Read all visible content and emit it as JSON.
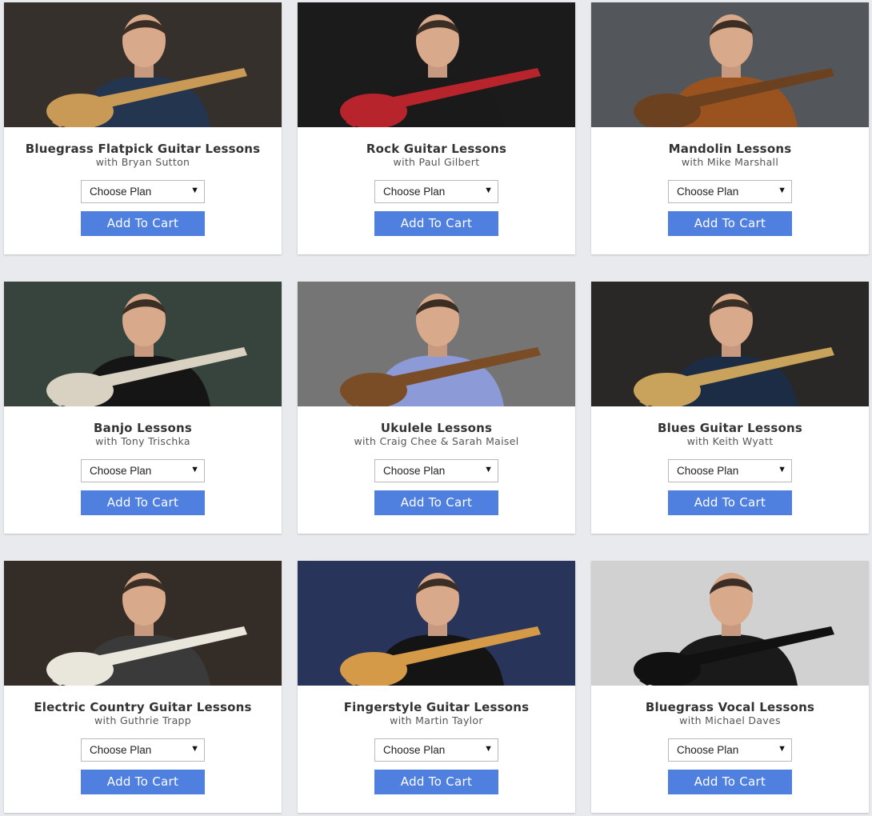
{
  "products": [
    {
      "title": "Bluegrass Flatpick Guitar Lessons",
      "instructor": "with Bryan Sutton",
      "plan": "Choose Plan",
      "cta": "Add To Cart",
      "photo_icon": "guitarist-acoustic-photo",
      "bg": "#2b2520",
      "shirt": "#24364f",
      "prop": "#c89a55"
    },
    {
      "title": "Rock Guitar Lessons",
      "instructor": "with Paul Gilbert",
      "plan": "Choose Plan",
      "cta": "Add To Cart",
      "photo_icon": "rock-guitarist-amps-photo",
      "bg": "#0f0f0f",
      "shirt": "#1a1a1a",
      "prop": "#b8242c"
    },
    {
      "title": "Mandolin Lessons",
      "instructor": "with Mike Marshall",
      "plan": "Choose Plan",
      "cta": "Add To Cart",
      "photo_icon": "mandolin-player-photo",
      "bg": "#4a4f53",
      "shirt": "#9a531f",
      "prop": "#6b4120"
    },
    {
      "title": "Banjo Lessons",
      "instructor": "with Tony Trischka",
      "plan": "Choose Plan",
      "cta": "Add To Cart",
      "photo_icon": "banjo-player-photo",
      "bg": "#2d3a33",
      "shirt": "#151515",
      "prop": "#d9d2c2"
    },
    {
      "title": "Ukulele Lessons",
      "instructor": "with Craig Chee & Sarah Maisel",
      "plan": "Choose Plan",
      "cta": "Add To Cart",
      "photo_icon": "ukulele-duo-photo",
      "bg": "#6e6e6e",
      "shirt": "#8d9ad8",
      "prop": "#7a4d26"
    },
    {
      "title": "Blues Guitar Lessons",
      "instructor": "with Keith Wyatt",
      "plan": "Choose Plan",
      "cta": "Add To Cart",
      "photo_icon": "blues-guitarist-photo",
      "bg": "#1e1d1b",
      "shirt": "#1c2c45",
      "prop": "#c9a25c"
    },
    {
      "title": "Electric Country Guitar Lessons",
      "instructor": "with Guthrie Trapp",
      "plan": "Choose Plan",
      "cta": "Add To Cart",
      "photo_icon": "electric-country-guitarist-photo",
      "bg": "#2a211b",
      "shirt": "#3a3a3a",
      "prop": "#e9e6dc"
    },
    {
      "title": "Fingerstyle Guitar Lessons",
      "instructor": "with Martin Taylor",
      "plan": "Choose Plan",
      "cta": "Add To Cart",
      "photo_icon": "fingerstyle-guitarist-photo",
      "bg": "#1d2a52",
      "shirt": "#141414",
      "prop": "#d49a48"
    },
    {
      "title": "Bluegrass Vocal Lessons",
      "instructor": "with Michael Daves",
      "plan": "Choose Plan",
      "cta": "Add To Cart",
      "photo_icon": "vocalist-microphone-photo",
      "bg": "#cfcfcf",
      "shirt": "#1a1a1a",
      "prop": "#111111"
    }
  ]
}
